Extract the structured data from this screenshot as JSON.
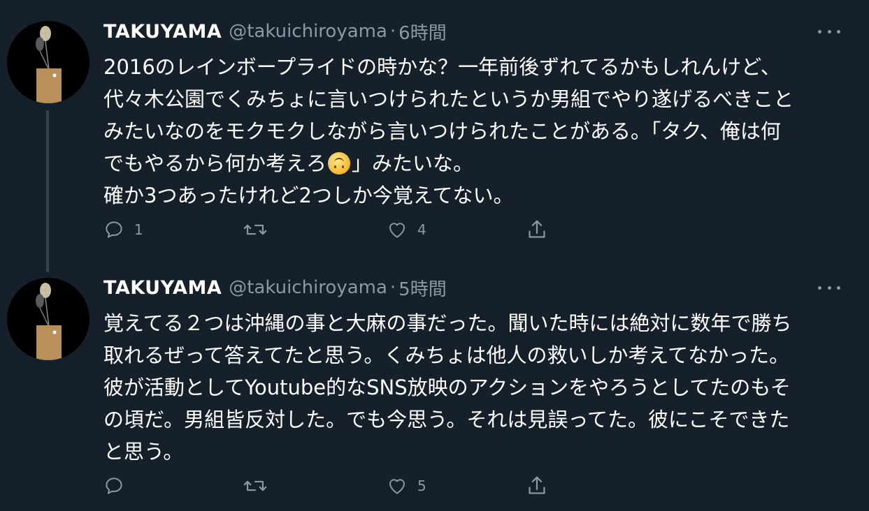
{
  "tweets": [
    {
      "name": "TAKUYAMA",
      "handle": "@takuichiroyama",
      "separator": "·",
      "time": "6時間",
      "lines": [
        "2016のレインボープライドの時かな？一年前後ずれてるかもしれんけど、",
        "代々木公園でくみちょに言いつけられたというか男組でやり遂げるべきこと",
        "みたいなのをモクモクしながら言いつけられたことがある。「タク、俺は何",
        "でもやるから何か考えろ",
        "」みたいな。",
        "確か3つあったけれど2つしか今覚えてない。"
      ],
      "emoji": "upside-down-face-emoji",
      "reply_count": "1",
      "retweet_count": "",
      "like_count": "4"
    },
    {
      "name": "TAKUYAMA",
      "handle": "@takuichiroyama",
      "separator": "·",
      "time": "5時間",
      "lines": [
        "覚えてる２つは沖縄の事と大麻の事だった。聞いた時には絶対に数年で勝ち",
        "取れるぜって答えてたと思う。くみちょは他人の救いしか考えてなかった。",
        "彼が活動としてYoutube的なSNS放映のアクションをやろうとしてたのもそ",
        "の頃だ。男組皆反対した。でも今思う。それは見誤ってた。彼にこそできた",
        "と思う。"
      ],
      "reply_count": "",
      "retweet_count": "",
      "like_count": "5"
    }
  ],
  "icons": {
    "reply": "reply-icon",
    "retweet": "retweet-icon",
    "like": "heart-icon",
    "share": "share-icon",
    "more": "more-icon"
  },
  "colors": {
    "background": "#15202b",
    "text": "#ffffff",
    "secondary": "#8b98a5",
    "thread_line": "#38444d"
  }
}
